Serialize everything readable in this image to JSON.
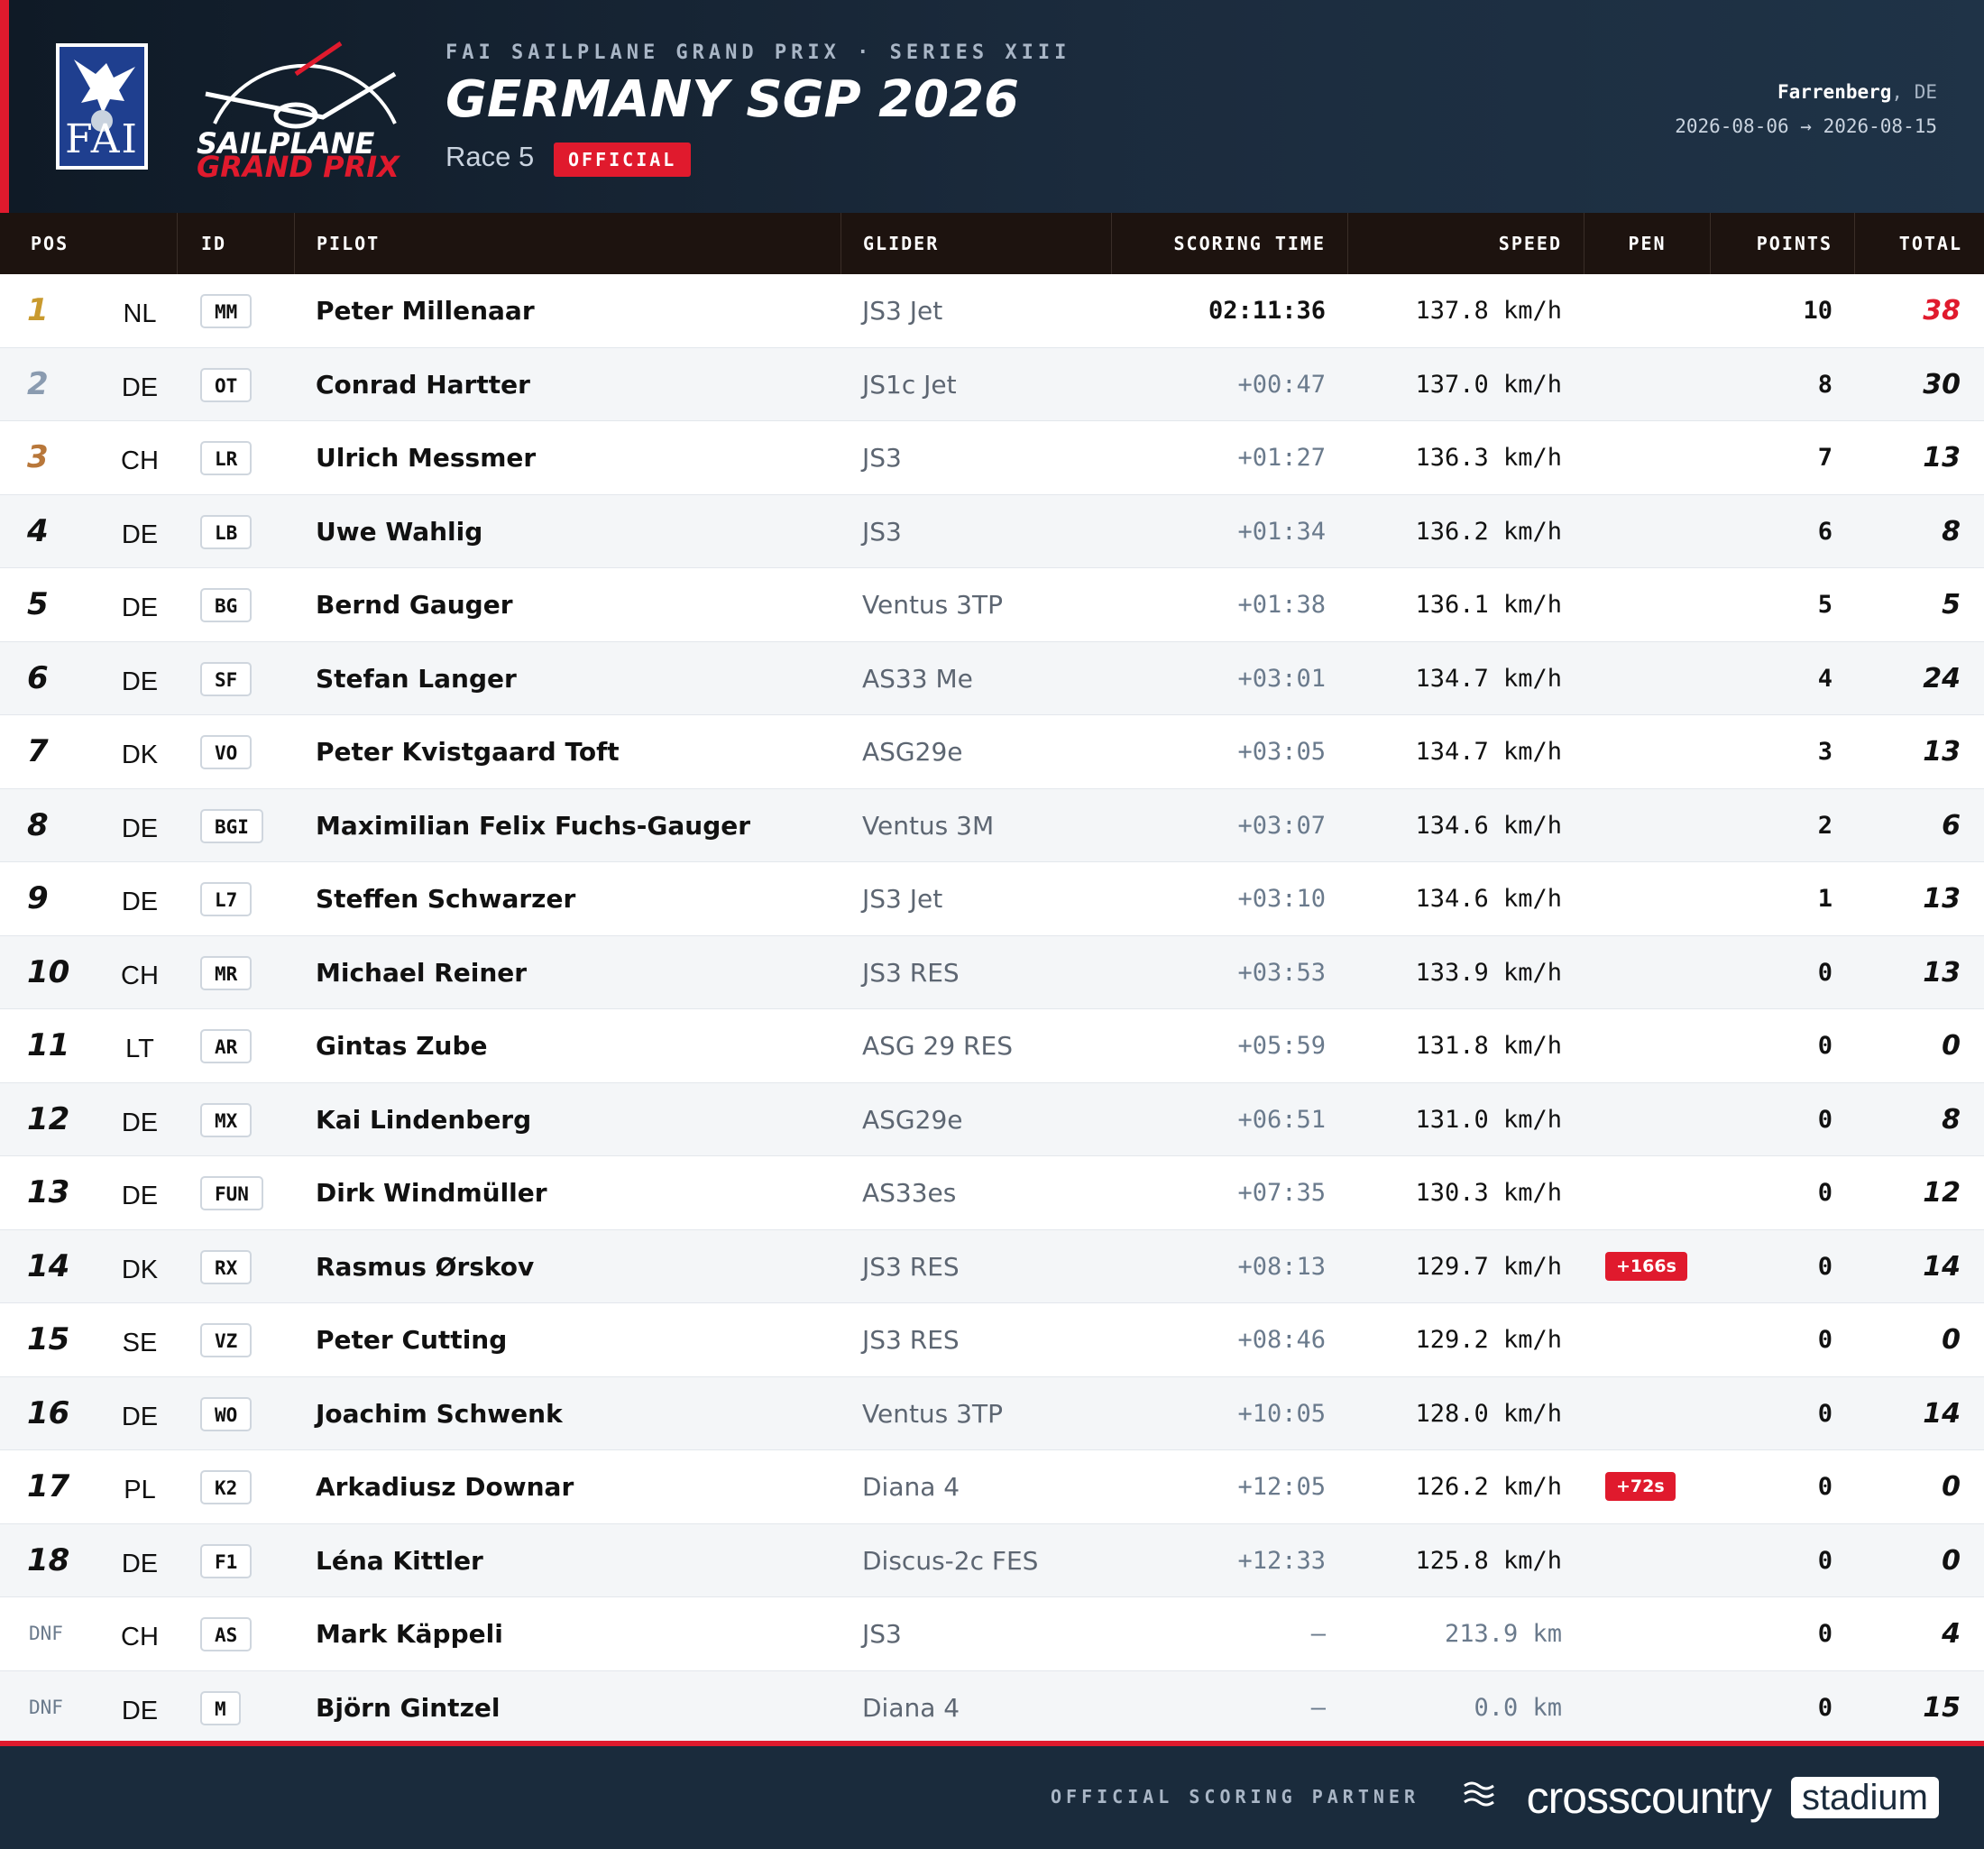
{
  "header": {
    "fai_logo_text": "FAI",
    "sgp_logo_line1": "SAILPLANE",
    "sgp_logo_line2": "GRAND PRIX",
    "series": "FAI SAILPLANE GRAND PRIX · SERIES XIII",
    "title": "GERMANY SGP 2026",
    "race": "Race 5",
    "status": "OFFICIAL",
    "venue_city": "Farrenberg",
    "venue_country": ", DE",
    "dates": "2026-08-06 → 2026-08-15"
  },
  "columns": {
    "pos": "POS",
    "id": "ID",
    "pilot": "PILOT",
    "glider": "GLIDER",
    "time": "SCORING TIME",
    "speed": "SPEED",
    "pen": "PEN",
    "points": "POINTS",
    "total": "TOTAL"
  },
  "results": [
    {
      "pos": "1",
      "nat": "NL",
      "id": "MM",
      "pilot": "Peter Millenaar",
      "glider": "JS3 Jet",
      "time": "02:11:36",
      "speed": "137.8 km/h",
      "pen": "",
      "points": "10",
      "total": "38"
    },
    {
      "pos": "2",
      "nat": "DE",
      "id": "OT",
      "pilot": "Conrad Hartter",
      "glider": "JS1c Jet",
      "time": "+00:47",
      "speed": "137.0 km/h",
      "pen": "",
      "points": "8",
      "total": "30"
    },
    {
      "pos": "3",
      "nat": "CH",
      "id": "LR",
      "pilot": "Ulrich Messmer",
      "glider": "JS3",
      "time": "+01:27",
      "speed": "136.3 km/h",
      "pen": "",
      "points": "7",
      "total": "13"
    },
    {
      "pos": "4",
      "nat": "DE",
      "id": "LB",
      "pilot": "Uwe Wahlig",
      "glider": "JS3",
      "time": "+01:34",
      "speed": "136.2 km/h",
      "pen": "",
      "points": "6",
      "total": "8"
    },
    {
      "pos": "5",
      "nat": "DE",
      "id": "BG",
      "pilot": "Bernd Gauger",
      "glider": "Ventus 3TP",
      "time": "+01:38",
      "speed": "136.1 km/h",
      "pen": "",
      "points": "5",
      "total": "5"
    },
    {
      "pos": "6",
      "nat": "DE",
      "id": "SF",
      "pilot": "Stefan Langer",
      "glider": "AS33 Me",
      "time": "+03:01",
      "speed": "134.7 km/h",
      "pen": "",
      "points": "4",
      "total": "24"
    },
    {
      "pos": "7",
      "nat": "DK",
      "id": "VO",
      "pilot": "Peter Kvistgaard Toft",
      "glider": "ASG29e",
      "time": "+03:05",
      "speed": "134.7 km/h",
      "pen": "",
      "points": "3",
      "total": "13"
    },
    {
      "pos": "8",
      "nat": "DE",
      "id": "BGI",
      "pilot": "Maximilian Felix Fuchs-Gauger",
      "glider": "Ventus 3M",
      "time": "+03:07",
      "speed": "134.6 km/h",
      "pen": "",
      "points": "2",
      "total": "6"
    },
    {
      "pos": "9",
      "nat": "DE",
      "id": "L7",
      "pilot": "Steffen Schwarzer",
      "glider": "JS3 Jet",
      "time": "+03:10",
      "speed": "134.6 km/h",
      "pen": "",
      "points": "1",
      "total": "13"
    },
    {
      "pos": "10",
      "nat": "CH",
      "id": "MR",
      "pilot": "Michael Reiner",
      "glider": "JS3 RES",
      "time": "+03:53",
      "speed": "133.9 km/h",
      "pen": "",
      "points": "0",
      "total": "13"
    },
    {
      "pos": "11",
      "nat": "LT",
      "id": "AR",
      "pilot": "Gintas Zube",
      "glider": "ASG 29 RES",
      "time": "+05:59",
      "speed": "131.8 km/h",
      "pen": "",
      "points": "0",
      "total": "0"
    },
    {
      "pos": "12",
      "nat": "DE",
      "id": "MX",
      "pilot": "Kai Lindenberg",
      "glider": "ASG29e",
      "time": "+06:51",
      "speed": "131.0 km/h",
      "pen": "",
      "points": "0",
      "total": "8"
    },
    {
      "pos": "13",
      "nat": "DE",
      "id": "FUN",
      "pilot": "Dirk Windmüller",
      "glider": "AS33es",
      "time": "+07:35",
      "speed": "130.3 km/h",
      "pen": "",
      "points": "0",
      "total": "12"
    },
    {
      "pos": "14",
      "nat": "DK",
      "id": "RX",
      "pilot": "Rasmus Ørskov",
      "glider": "JS3 RES",
      "time": "+08:13",
      "speed": "129.7 km/h",
      "pen": "+166s",
      "points": "0",
      "total": "14"
    },
    {
      "pos": "15",
      "nat": "SE",
      "id": "VZ",
      "pilot": "Peter Cutting",
      "glider": "JS3 RES",
      "time": "+08:46",
      "speed": "129.2 km/h",
      "pen": "",
      "points": "0",
      "total": "0"
    },
    {
      "pos": "16",
      "nat": "DE",
      "id": "WO",
      "pilot": "Joachim Schwenk",
      "glider": "Ventus 3TP",
      "time": "+10:05",
      "speed": "128.0 km/h",
      "pen": "",
      "points": "0",
      "total": "14"
    },
    {
      "pos": "17",
      "nat": "PL",
      "id": "K2",
      "pilot": "Arkadiusz Downar",
      "glider": "Diana 4",
      "time": "+12:05",
      "speed": "126.2 km/h",
      "pen": "+72s",
      "points": "0",
      "total": "0"
    },
    {
      "pos": "18",
      "nat": "DE",
      "id": "F1",
      "pilot": "Léna Kittler",
      "glider": "Discus-2c FES",
      "time": "+12:33",
      "speed": "125.8 km/h",
      "pen": "",
      "points": "0",
      "total": "0"
    },
    {
      "pos": "DNF",
      "nat": "CH",
      "id": "AS",
      "pilot": "Mark Käppeli",
      "glider": "JS3",
      "time": "–",
      "speed": "213.9 km",
      "pen": "",
      "points": "0",
      "total": "4"
    },
    {
      "pos": "DNF",
      "nat": "DE",
      "id": "M",
      "pilot": "Björn Gintzel",
      "glider": "Diana 4",
      "time": "–",
      "speed": "0.0 km",
      "pen": "",
      "points": "0",
      "total": "15"
    }
  ],
  "footer": {
    "partner_label": "OFFICIAL SCORING PARTNER",
    "brand": "crosscountry",
    "brand_badge": "stadium"
  },
  "colors": {
    "accent": "#e01a2d",
    "header_bg": "#1b2b3d",
    "table_head_bg": "#1d130f",
    "gold": "#c99a2e",
    "silver": "#8a9bb0",
    "bronze": "#b8773a"
  }
}
